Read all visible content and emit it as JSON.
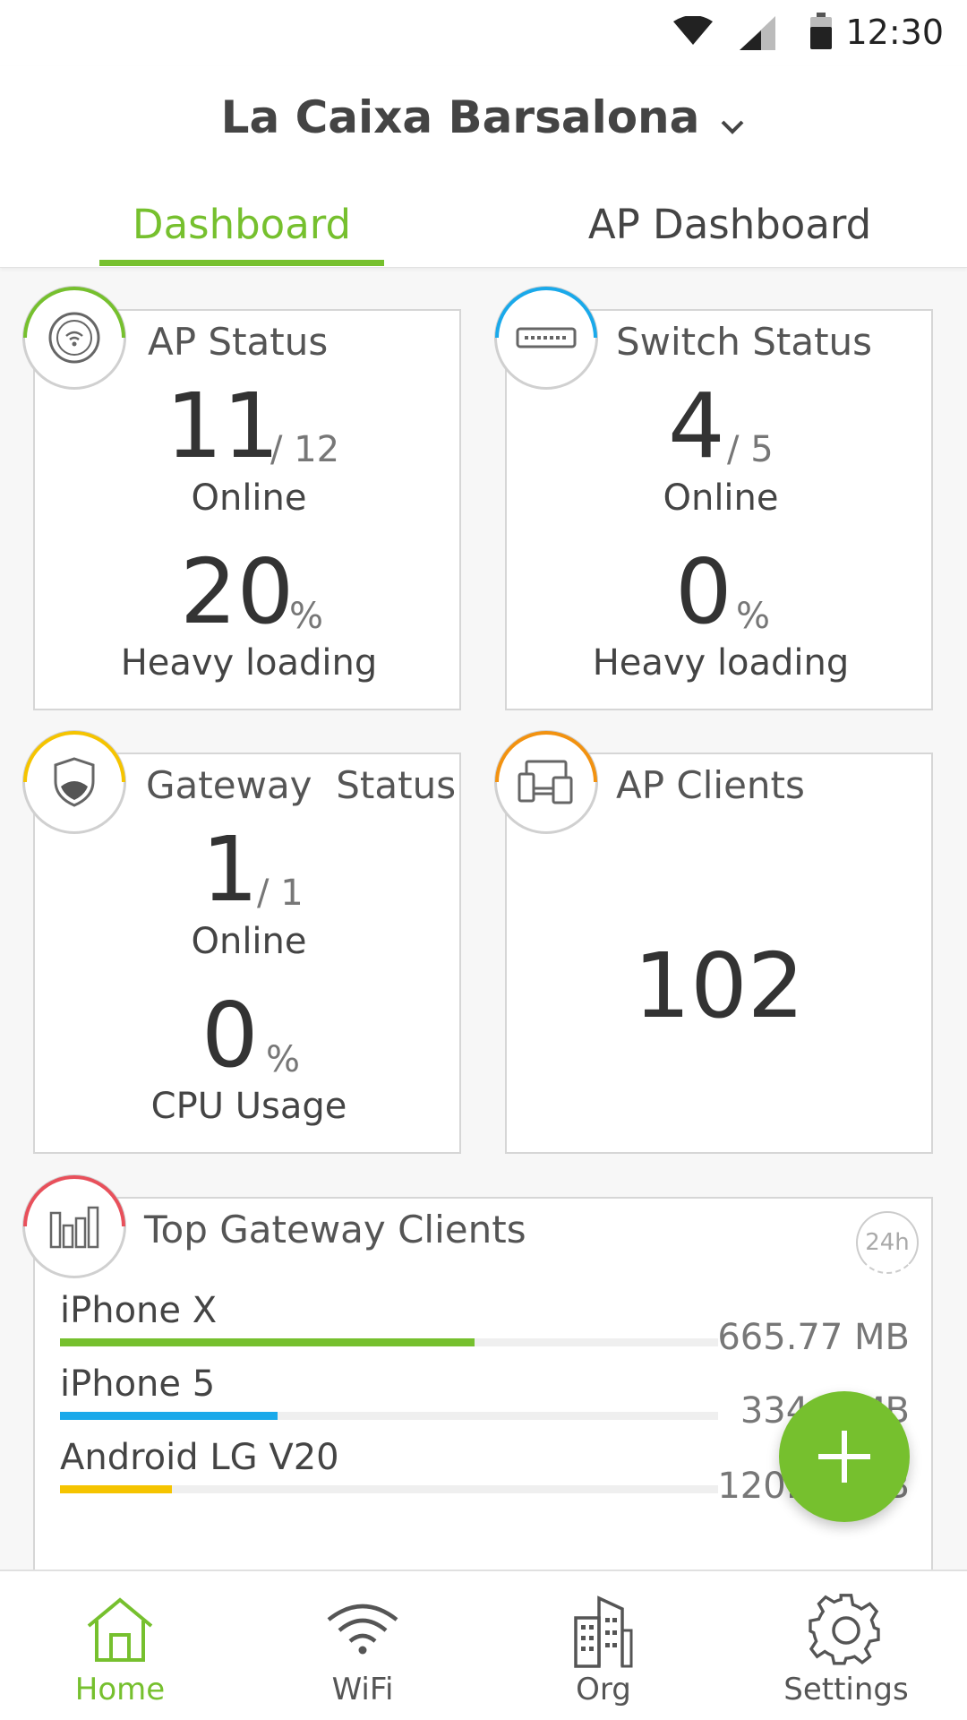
{
  "status_bar": {
    "time": "12:30",
    "icons": [
      "wifi-icon",
      "signal-icon",
      "battery-icon"
    ]
  },
  "header": {
    "site_name": "La Caixa Barsalona",
    "tabs": [
      {
        "label": "Dashboard",
        "active": true
      },
      {
        "label": "AP Dashboard",
        "active": false
      }
    ]
  },
  "colors": {
    "accent": "#76c02e",
    "ap": "#76c02e",
    "switch": "#1aa9ea",
    "gateway": "#f5c400",
    "clients": "#f29210",
    "top_clients": "#e8505b"
  },
  "cards": {
    "ap_status": {
      "title": "AP Status",
      "icon": "ap-icon",
      "online": "11",
      "total": "/ 12",
      "online_label": "Online",
      "load": "20",
      "load_unit": "%",
      "load_label": "Heavy loading"
    },
    "switch_status": {
      "title": "Switch Status",
      "icon": "switch-icon",
      "online": "4",
      "total": "/ 5",
      "online_label": "Online",
      "load": "0",
      "load_unit": "%",
      "load_label": "Heavy loading"
    },
    "gateway_status": {
      "title": "Gateway  Status",
      "icon": "shield-icon",
      "online": "1",
      "total": "/ 1",
      "online_label": "Online",
      "load": "0",
      "load_unit": "%",
      "load_label": "CPU Usage"
    },
    "ap_clients": {
      "title": "AP Clients",
      "icon": "devices-icon",
      "count": "102"
    },
    "top_gateway_clients": {
      "title": "Top Gateway Clients",
      "icon": "bar-chart-icon",
      "period": "24h",
      "items": [
        {
          "name": "iPhone X",
          "value": "665.77 MB",
          "fraction": 0.63,
          "color": "#76c02e"
        },
        {
          "name": "iPhone 5",
          "value": "334.1 MB",
          "fraction": 0.33,
          "color": "#1aa9ea"
        },
        {
          "name": "Android LG V20",
          "value": "120.12 MB",
          "fraction": 0.17,
          "color": "#f5c400"
        }
      ]
    }
  },
  "fab": {
    "icon": "plus-icon"
  },
  "bottom_nav": [
    {
      "label": "Home",
      "icon": "home-icon",
      "active": true
    },
    {
      "label": "WiFi",
      "icon": "wifi-icon",
      "active": false
    },
    {
      "label": "Org",
      "icon": "building-icon",
      "active": false
    },
    {
      "label": "Settings",
      "icon": "gear-icon",
      "active": false
    }
  ]
}
